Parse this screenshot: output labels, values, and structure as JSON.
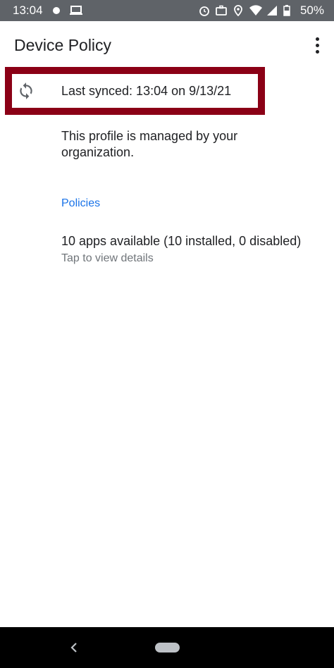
{
  "status_bar": {
    "time": "13:04",
    "battery": "50%",
    "left_icons": [
      "notification-dot-icon",
      "laptop-icon"
    ],
    "right_icons": [
      "alarm-icon",
      "work-briefcase-icon",
      "location-icon",
      "wifi-icon",
      "signal-icon",
      "battery-icon"
    ]
  },
  "app_bar": {
    "title": "Device Policy",
    "menu_icon": "more-vert-icon"
  },
  "sync": {
    "label": "Last synced: 13:04 on 9/13/21",
    "icon": "sync-icon",
    "highlight_color": "#8b0016"
  },
  "managed_text": "This profile is managed by your organization.",
  "policies": {
    "header": "Policies",
    "header_color": "#1a73e8",
    "item_title": "10 apps available (10 installed, 0 disabled)",
    "item_subtitle": "Tap to view details"
  },
  "nav_bar": {
    "back_icon": "back-icon",
    "home_icon": "home-pill-icon"
  }
}
